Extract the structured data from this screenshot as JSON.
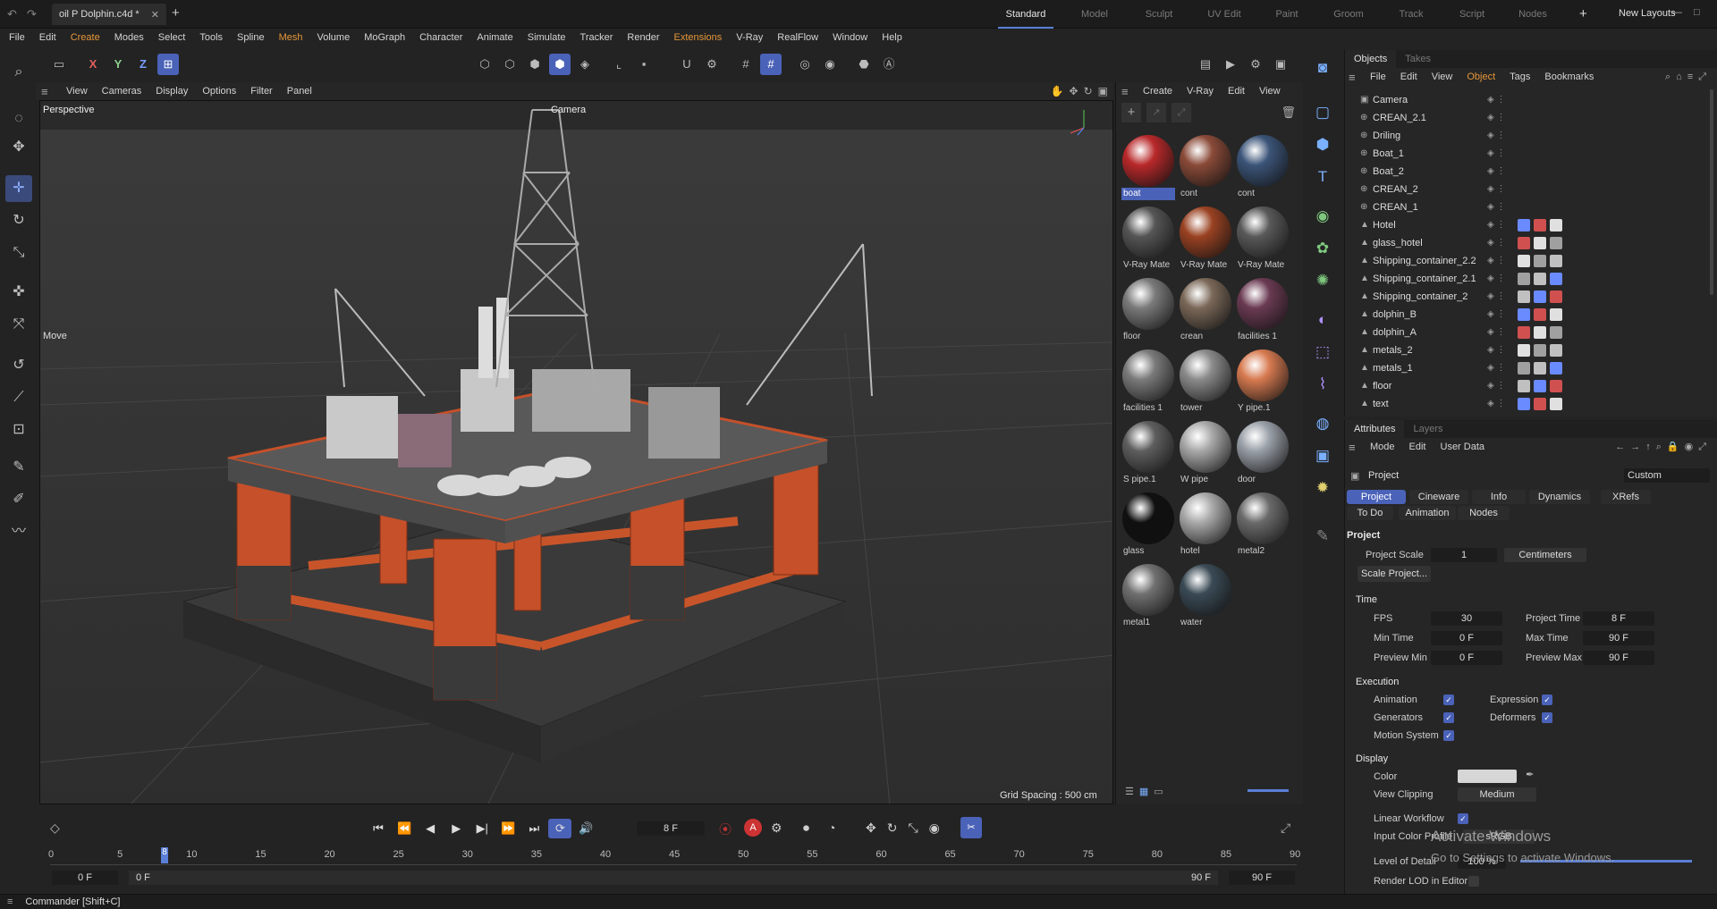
{
  "document": {
    "title": "oil P Dolphin.c4d *"
  },
  "layouts": [
    "Standard",
    "Model",
    "Sculpt",
    "UV Edit",
    "Paint",
    "Groom",
    "Track",
    "Script",
    "Nodes"
  ],
  "new_layouts": "New Layouts",
  "menu": [
    "File",
    "Edit",
    "Create",
    "Modes",
    "Select",
    "Tools",
    "Spline",
    "Mesh",
    "Volume",
    "MoGraph",
    "Character",
    "Animate",
    "Simulate",
    "Tracker",
    "Render",
    "Extensions",
    "V-Ray",
    "RealFlow",
    "Window",
    "Help"
  ],
  "axes": [
    "X",
    "Y",
    "Z"
  ],
  "viewport": {
    "menu": [
      "View",
      "Cameras",
      "Display",
      "Options",
      "Filter",
      "Panel"
    ],
    "projection": "Perspective",
    "camera": "Camera",
    "tool": "Move",
    "grid_spacing": "Grid Spacing : 500 cm"
  },
  "materials": {
    "menu": [
      "Create",
      "V-Ray",
      "Edit",
      "View"
    ],
    "items": [
      {
        "name": "boat",
        "color": "#b8282a"
      },
      {
        "name": "cont",
        "color": "#8a4a38"
      },
      {
        "name": "cont",
        "color": "#3b5478"
      },
      {
        "name": "V-Ray Mate",
        "color": "#555555"
      },
      {
        "name": "V-Ray Mate",
        "color": "#9a4222"
      },
      {
        "name": "V-Ray Mate",
        "color": "#595959"
      },
      {
        "name": "floor",
        "color": "#7a7a7a"
      },
      {
        "name": "crean",
        "color": "#7a6858"
      },
      {
        "name": "facilities 1",
        "color": "#6a3a52"
      },
      {
        "name": "facilities 1",
        "color": "#7a7a7a"
      },
      {
        "name": "tower",
        "color": "#8a8a8a"
      },
      {
        "name": "Y pipe.1",
        "color": "#d77a50"
      },
      {
        "name": "S pipe.1",
        "color": "#5e5e5e"
      },
      {
        "name": "W pipe",
        "color": "#a8a8a8"
      },
      {
        "name": "door",
        "color": "#9aa0a8"
      },
      {
        "name": "glass",
        "color": "#101010"
      },
      {
        "name": "hotel",
        "color": "#a9a9a9"
      },
      {
        "name": "metal2",
        "color": "#6a6a6a"
      },
      {
        "name": "metal1",
        "color": "#707070"
      },
      {
        "name": "water",
        "color": "#3a4a55"
      }
    ]
  },
  "objects": {
    "tabs": [
      "Objects",
      "Takes"
    ],
    "menu": [
      "File",
      "Edit",
      "View",
      "Object",
      "Tags",
      "Bookmarks"
    ],
    "items": [
      "Camera",
      "CREAN_2.1",
      "Driling",
      "Boat_1",
      "Boat_2",
      "CREAN_2",
      "CREAN_1",
      "Hotel",
      "glass_hotel",
      "Shipping_container_2.2",
      "Shipping_container_2.1",
      "Shipping_container_2",
      "dolphin_B",
      "dolphin_A",
      "metals_2",
      "metals_1",
      "floor",
      "text"
    ]
  },
  "attributes": {
    "tabs": [
      "Attributes",
      "Layers"
    ],
    "menu": [
      "Mode",
      "Edit",
      "User Data"
    ],
    "object": "Project",
    "mode": "Custom",
    "subtabs": [
      "Project",
      "Cineware",
      "Info",
      "Dynamics",
      "XRefs",
      "To Do",
      "Animation",
      "Nodes"
    ],
    "section_project": "Project",
    "project_scale_label": "Project Scale",
    "project_scale": "1",
    "units": "Centimeters",
    "scale_button": "Scale Project...",
    "section_time": "Time",
    "fps_label": "FPS",
    "fps": "30",
    "project_time_label": "Project Time",
    "project_time": "8 F",
    "min_time_label": "Min Time",
    "min_time": "0 F",
    "max_time_label": "Max Time",
    "max_time": "90 F",
    "preview_min_label": "Preview Min",
    "preview_min": "0 F",
    "preview_max_label": "Preview Max",
    "preview_max": "90 F",
    "section_execution": "Execution",
    "animation": "Animation",
    "expression": "Expression",
    "generators": "Generators",
    "deformers": "Deformers",
    "motion_system": "Motion System",
    "section_display": "Display",
    "color_label": "Color",
    "view_clipping_label": "View Clipping",
    "view_clipping": "Medium",
    "linear_workflow": "Linear Workflow",
    "input_color_profile": "Input Color Profile",
    "input_color_value": "sRGB",
    "level_of_detail": "Level of Detail",
    "lod_value": "100 %",
    "render_lod": "Render LOD in Editor"
  },
  "timeline": {
    "current_frame": "8 F",
    "start": "0 F",
    "end": "90 F",
    "start2": "0 F",
    "end2": "90 F",
    "end3": "90 F",
    "ticks": [
      "0",
      "5",
      "10",
      "15",
      "20",
      "25",
      "30",
      "35",
      "40",
      "45",
      "50",
      "55",
      "60",
      "65",
      "70",
      "75",
      "80",
      "85",
      "90"
    ],
    "playhead": "8"
  },
  "status": "Commander [Shift+C]",
  "watermark": {
    "line1": "Activate Windows",
    "line2": "Go to Settings to activate Windows."
  }
}
